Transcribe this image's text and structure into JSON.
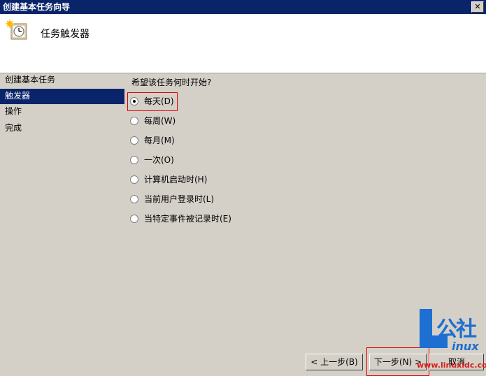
{
  "window": {
    "title": "创建基本任务向导",
    "close_label": "✕"
  },
  "header": {
    "heading": "任务触发器",
    "icon": "scheduler-clock-icon"
  },
  "sidebar": {
    "items": [
      {
        "label": "创建基本任务",
        "selected": false
      },
      {
        "label": "触发器",
        "selected": true
      },
      {
        "label": "操作",
        "selected": false
      },
      {
        "label": "完成",
        "selected": false
      }
    ]
  },
  "main": {
    "question": "希望该任务何时开始?",
    "options": [
      {
        "label": "每天(D)",
        "checked": true
      },
      {
        "label": "每周(W)",
        "checked": false
      },
      {
        "label": "每月(M)",
        "checked": false
      },
      {
        "label": "一次(O)",
        "checked": false
      },
      {
        "label": "计算机启动时(H)",
        "checked": false
      },
      {
        "label": "当前用户登录时(L)",
        "checked": false
      },
      {
        "label": "当特定事件被记录时(E)",
        "checked": false
      }
    ]
  },
  "footer": {
    "back_label": "< 上一步(B)",
    "next_label": "下一步(N) >",
    "cancel_label": "取消"
  },
  "watermark": {
    "logo_text": "公社",
    "logo_sub": "inux",
    "url": "www.linuxidc.com"
  },
  "colors": {
    "titlebar": "#0a246a",
    "selection": "#0a246a",
    "highlight": "#e00000",
    "watermark": "#1d6fd1"
  }
}
